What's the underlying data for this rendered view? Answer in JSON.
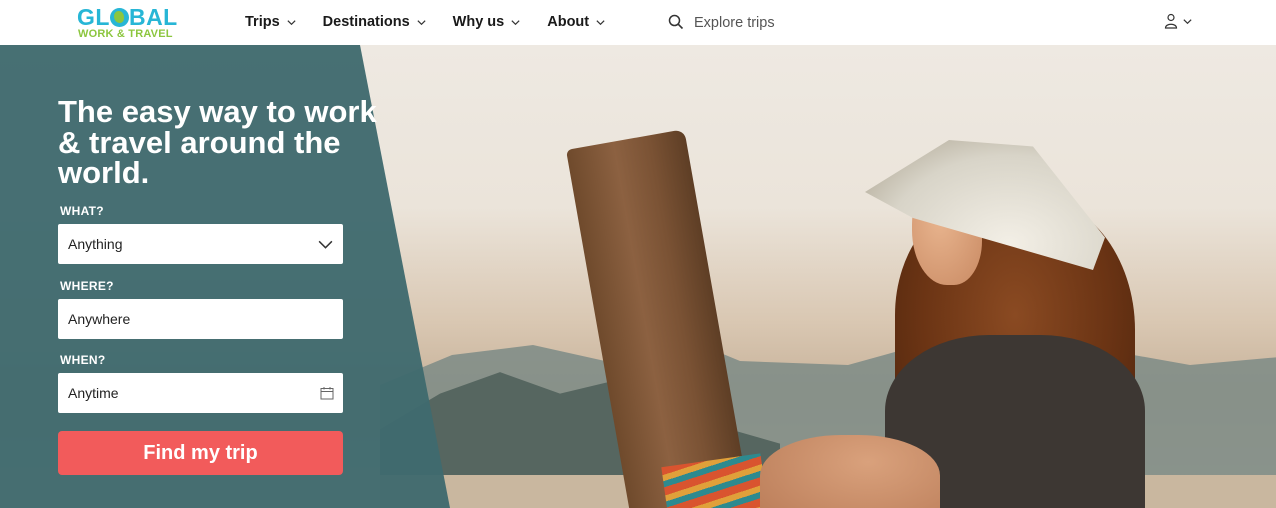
{
  "logo": {
    "line1": "GL",
    "line1b": "BAL",
    "line2": "WORK & TRAVEL"
  },
  "nav": {
    "items": [
      {
        "label": "Trips"
      },
      {
        "label": "Destinations"
      },
      {
        "label": "Why us"
      },
      {
        "label": "About"
      }
    ]
  },
  "search": {
    "placeholder": "Explore trips",
    "icon": "search-icon"
  },
  "user": {
    "icon": "user-icon"
  },
  "hero": {
    "headline": "The easy way to work & travel around the world.",
    "what": {
      "label": "WHAT?",
      "value": "Anything"
    },
    "where": {
      "label": "WHERE?",
      "value": "Anywhere"
    },
    "when": {
      "label": "WHEN?",
      "value": "Anytime"
    },
    "cta": "Find my trip"
  },
  "colors": {
    "brand_blue": "#27b6d6",
    "brand_green": "#8cc63f",
    "panel_teal": "#3f6a6e",
    "cta": "#f25b5b"
  }
}
